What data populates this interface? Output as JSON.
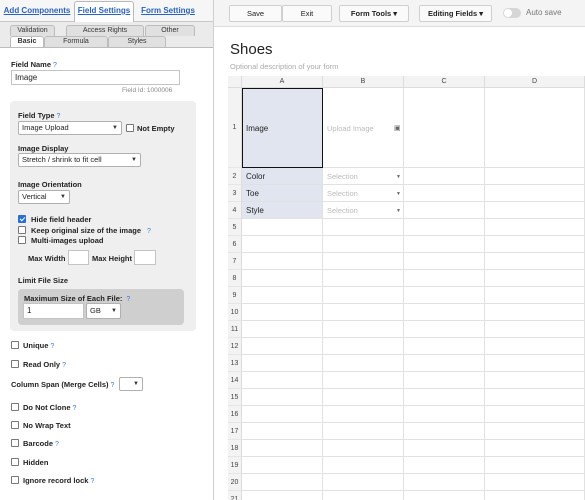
{
  "top_tabs": [
    "Add Components",
    "Field Settings",
    "Form Settings"
  ],
  "sub_tabs_row1": [
    "Validation",
    "Access Rights",
    "Other"
  ],
  "sub_tabs_row2": [
    "Basic",
    "Formula",
    "Styles"
  ],
  "help_mark": "?",
  "field_name": {
    "label": "Field Name",
    "value": "Image",
    "field_id": "Field Id: 1000006"
  },
  "field_type": {
    "label": "Field Type",
    "value": "Image Upload",
    "not_empty_label": "Not Empty"
  },
  "image_display": {
    "label": "Image Display",
    "value": "Stretch / shrink to fit cell"
  },
  "image_orientation": {
    "label": "Image Orientation",
    "value": "Vertical"
  },
  "options": {
    "hide_header": "Hide field header",
    "keep_original": "Keep original size of the image",
    "multi_upload": "Multi-images upload",
    "max_width": "Max Width",
    "max_height": "Max Height"
  },
  "limit": {
    "label": "Limit File Size",
    "max_label": "Maximum Size of Each File:",
    "size_value": "1",
    "unit": "GB"
  },
  "checks": {
    "unique": "Unique",
    "read_only": "Read Only",
    "column_span": "Column Span (Merge Cells)",
    "do_not_clone": "Do Not Clone",
    "no_wrap": "No Wrap Text",
    "barcode": "Barcode",
    "hidden": "Hidden",
    "ignore_lock": "Ignore record lock"
  },
  "toolbar": {
    "save": "Save",
    "exit": "Exit",
    "form_tools": "Form Tools",
    "editing_fields": "Editing Fields",
    "autosave": "Auto save"
  },
  "form": {
    "title": "Shoes",
    "description": "Optional description of your form"
  },
  "columns": [
    "A",
    "B",
    "C",
    "D"
  ],
  "rows": [
    "1",
    "2",
    "3",
    "4",
    "5",
    "6",
    "7",
    "8",
    "9",
    "10",
    "11",
    "12",
    "13",
    "14",
    "15",
    "16",
    "17",
    "18",
    "19",
    "20",
    "21"
  ],
  "cells": {
    "a1": "Image",
    "b1": "Upload Image",
    "a2": "Color",
    "b2": "Selection",
    "a3": "Toe",
    "b3": "Selection",
    "a4": "Style",
    "b4": "Selection"
  },
  "colors": {
    "accent": "#2a63b8",
    "label_cell": "#e1e5ef",
    "selected_border": "#111111"
  }
}
